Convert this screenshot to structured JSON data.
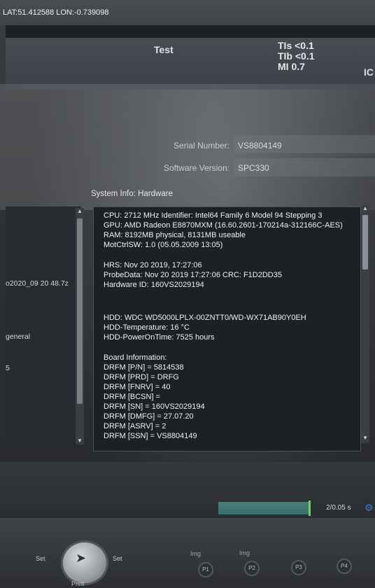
{
  "coordinates": "LAT:51.412588 LON:-0.739098",
  "header": {
    "preset": "Test",
    "tis": "TIs <0.1",
    "tib": "TIb <0.1",
    "mi": "MI  0.7",
    "edge_letter": "IC"
  },
  "info": {
    "serial_label": "Serial Number:",
    "serial_value": "VS8804149",
    "software_label": "Software Version:",
    "software_value": "SPC330"
  },
  "system_info": {
    "title": "System Info: Hardware",
    "lines": [
      "CPU: 2712 MHz Identifier: Intel64 Family 6 Model 94 Stepping 3",
      "GPU: AMD Radeon E8870MXM (16.60.2601-170214a-312166C-AES)",
      "RAM: 8192MB physical, 8131MB useable",
      "MotCtrlSW: 1.0 (05.05.2009 13:05)",
      "HRS: Nov 20 2019, 17:27:06",
      "ProbeData: Nov 20 2019  17:27:06  CRC: F1D2DD35",
      "Hardware ID: 160VS2029194",
      "HDD: WDC WD5000LPLX-00ZNTT0/WD-WX71AB90Y0EH",
      "HDD-Temperature: 16 °C",
      "HDD-PowerOnTime: 7525 hours",
      "Board Information:",
      "DRFM [P/N] = 5814538",
      "DRFM [PRD] = DRFG",
      "DRFM [FNRV] = 40",
      "DRFM [BCSN] =",
      "DRFM [SN] = 160VS2029194",
      "DRFM [DMFG] = 27.07.20",
      "DRFM [ASRV] = 2",
      "DRFM [SSN] = VS8804149"
    ]
  },
  "left_list": {
    "item_1": "o2020_09 20 48.7z",
    "item_2": "general",
    "item_3": "5"
  },
  "bottom": {
    "progress_fraction": 0.98,
    "progress_label": "2/0.05 s",
    "set_left": "Set",
    "set_right": "Set",
    "print": "Print",
    "p1": "P1",
    "p2": "P2",
    "p3": "P3",
    "p4": "P4",
    "img_1": "Img",
    "img_2": "Img"
  },
  "icons": {
    "gear": "gear-icon",
    "cursor": "cursor-icon",
    "scroll_up": "triangle-up-icon",
    "scroll_down": "triangle-down-icon"
  }
}
